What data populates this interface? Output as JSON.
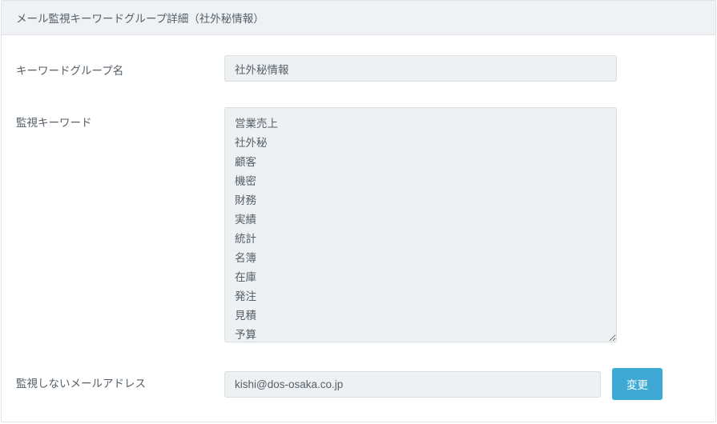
{
  "panel": {
    "title": "メール監視キーワードグループ詳細（社外秘情報）"
  },
  "form": {
    "group_name": {
      "label": "キーワードグループ名",
      "value": "社外秘情報"
    },
    "keywords": {
      "label": "監視キーワード",
      "value": "営業売上\n社外秘\n顧客\n機密\n財務\n実績\n統計\n名簿\n在庫\n発注\n見積\n予算"
    },
    "exclude_email": {
      "label": "監視しないメールアドレス",
      "value": "kishi@dos-osaka.co.jp"
    },
    "submit_label": "変更"
  }
}
